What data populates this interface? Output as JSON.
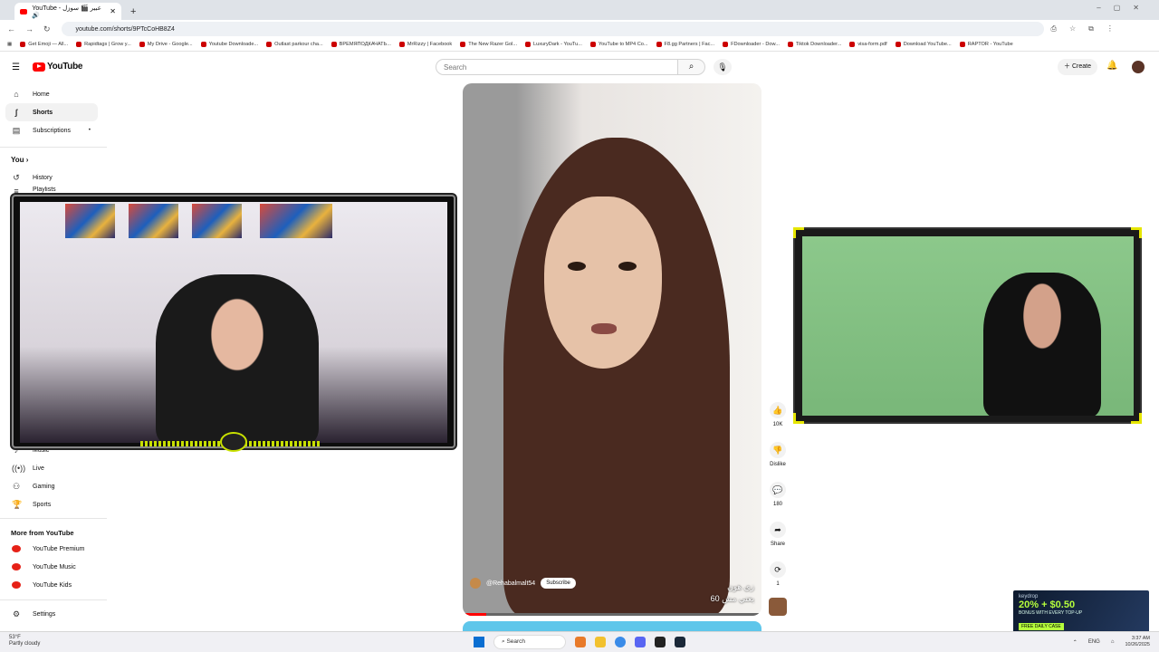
{
  "browser": {
    "tab_title": "YouTube - عبير 🎬 سوزل 🔊",
    "url": "youtube.com/shorts/9PTcCoHB8Z4",
    "bookmarks": [
      "Get Emoji — All...",
      "Rapidtags | Grow y...",
      "My Drive - Google...",
      "Youtube Downloade...",
      "Outlast parkour cha...",
      "ВРЕМЯПОДКАЧАТЬ...",
      "MrRizzy | Facebook",
      "The New Razer Gol...",
      "LuxuryDark - YouTu...",
      "YouTube to MP4 Co...",
      "F8.gg Partners | Fac...",
      "FDownloader - Dow...",
      "Tiktok Downloader...",
      "visa-form.pdf",
      "Download YouTube...",
      "RAPTOR - YouTube"
    ]
  },
  "header": {
    "logo_text": "YouTube",
    "search_placeholder": "Search",
    "create_label": "Create"
  },
  "sidebar": {
    "home": "Home",
    "shorts": "Shorts",
    "subscriptions": "Subscriptions",
    "you": "You",
    "history": "History",
    "playlists": "Playlists",
    "music": "Music",
    "live": "Live",
    "gaming": "Gaming",
    "sports": "Sports",
    "more_heading": "More from YouTube",
    "premium": "YouTube Premium",
    "yt_music": "YouTube Music",
    "kids": "YouTube Kids",
    "settings": "Settings"
  },
  "short": {
    "channel": "@Rehabalmalt54",
    "subscribe": "Subscribe",
    "caption_ar_1": "زي هون",
    "caption_ar_2": "يعني مش 60",
    "progress_fraction": 0.08
  },
  "actions": {
    "likes": "10K",
    "dislike": "Dislike",
    "comments": "180",
    "share": "Share",
    "remix": "1"
  },
  "ad": {
    "brand": "keydrop",
    "headline": "20% + $0.50",
    "sub": "BONUS WITH EVERY TOP-UP",
    "cta": "FREE DAILY CASE"
  },
  "taskbar": {
    "temp": "53°F",
    "weather": "Partly cloudy",
    "search": "Search",
    "lang": "ENG",
    "time": "3:37 AM",
    "date": "10/26/2025"
  }
}
